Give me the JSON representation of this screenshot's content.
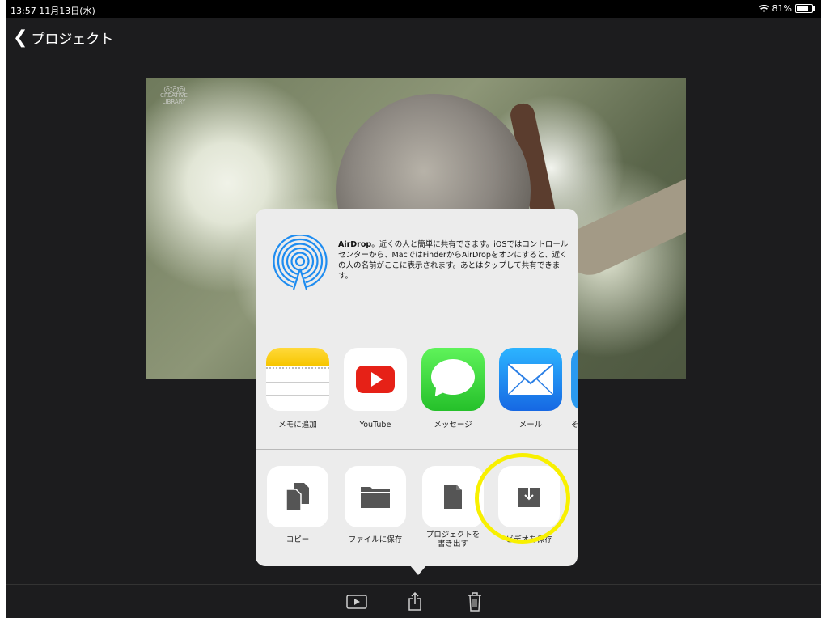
{
  "status_bar": {
    "time": "13:57  11月13日(水)",
    "battery": "81%",
    "battery_level": 0.81
  },
  "nav": {
    "back_label": "プロジェクト"
  },
  "video": {
    "logo_text": "CREATIVE LIBRARY"
  },
  "share_sheet": {
    "airdrop_title": "AirDrop",
    "airdrop_text": "。近くの人と簡単に共有できます。iOSではコントロールセンターから、MacではFinderからAirDropをオンにすると、近くの人の名前がここに表示されます。あとはタップして共有できます。",
    "apps": [
      {
        "label": "メモに追加",
        "icon": "notes-icon"
      },
      {
        "label": "YouTube",
        "icon": "youtube-icon"
      },
      {
        "label": "メッセージ",
        "icon": "messages-icon"
      },
      {
        "label": "メール",
        "icon": "mail-icon"
      },
      {
        "label": "そ",
        "icon": "more-icon"
      }
    ],
    "actions": [
      {
        "label": "コピー",
        "icon": "copy-icon"
      },
      {
        "label": "ファイルに保存",
        "icon": "folder-icon"
      },
      {
        "label": "プロジェクトを\n書き出す",
        "icon": "document-icon"
      },
      {
        "label": "ビデオを保存",
        "icon": "save-video-icon"
      }
    ]
  },
  "colors": {
    "highlight": "#f8f000",
    "airdrop_blue": "#1e8cf0",
    "youtube_red": "#e62117",
    "messages_green": "#34c759",
    "mail_blue": "#1f8ef1"
  }
}
